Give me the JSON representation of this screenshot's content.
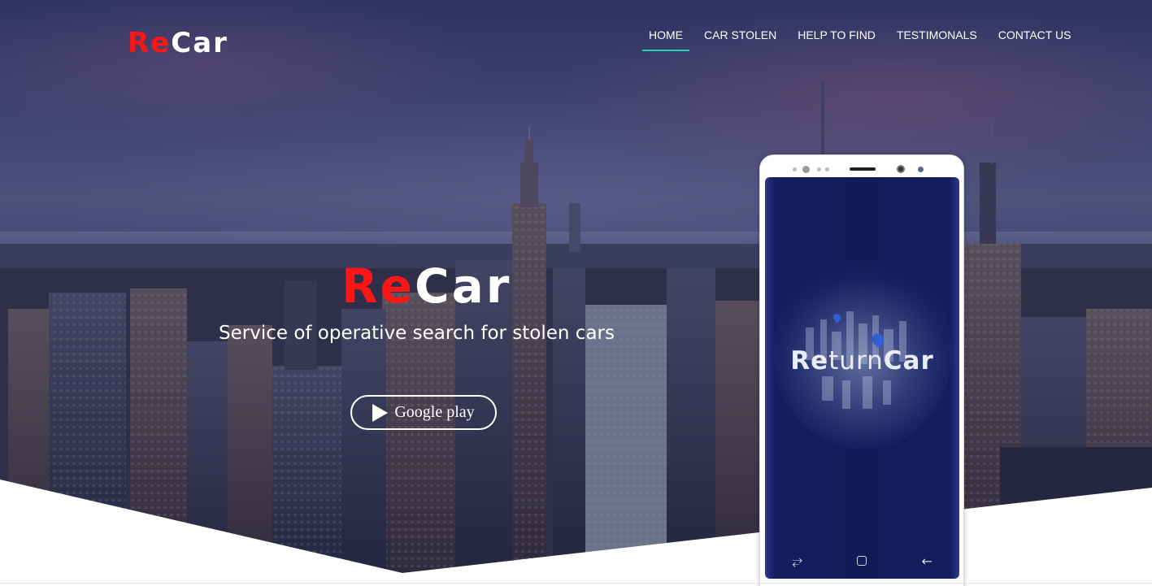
{
  "header": {
    "logo": {
      "prefix": "Re",
      "suffix": "Car"
    },
    "nav": [
      {
        "label": "HOME",
        "active": true
      },
      {
        "label": "CAR STOLEN",
        "active": false
      },
      {
        "label": "HELP TO FIND",
        "active": false
      },
      {
        "label": "TESTIMONALS",
        "active": false
      },
      {
        "label": "CONTACT US",
        "active": false
      }
    ]
  },
  "hero": {
    "title": {
      "prefix": "Re",
      "suffix": "Car"
    },
    "subtitle": "Service of operative search for stolen cars",
    "cta": {
      "label": "Google play",
      "icon": "play-icon"
    }
  },
  "phone": {
    "app_name": {
      "part1": "Re",
      "part2": "turn",
      "part3": "Car"
    },
    "softkeys": {
      "recent": "⥂",
      "back": "←"
    }
  },
  "colors": {
    "brand_red": "#ff1515",
    "nav_active_underline": "#2bd2b0",
    "overlay": "#161c50",
    "phone_screen": "#111b58"
  }
}
